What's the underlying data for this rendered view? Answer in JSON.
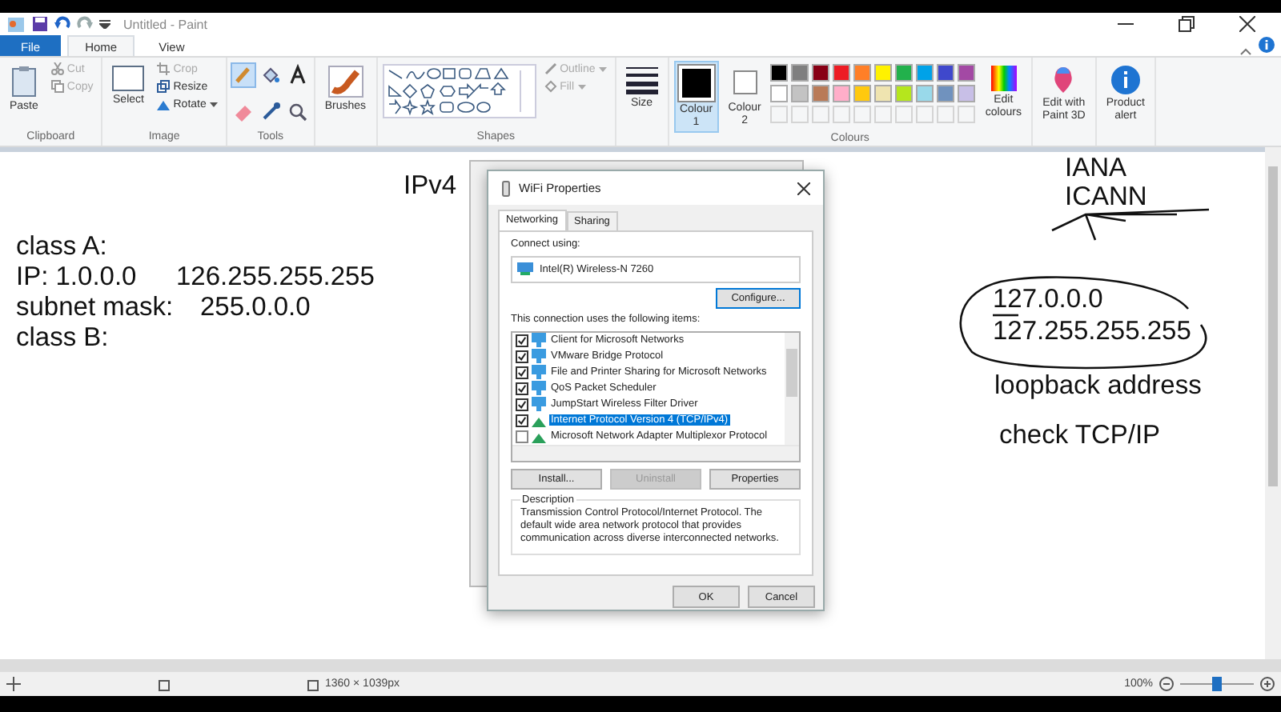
{
  "window": {
    "title": "Untitled - Paint"
  },
  "ribbon_tabs": [
    {
      "label": "File",
      "kind": "file",
      "selected": false
    },
    {
      "label": "Home",
      "kind": "tab",
      "selected": true
    },
    {
      "label": "View",
      "kind": "tab",
      "selected": false
    }
  ],
  "ribbon": {
    "clipboard": {
      "label": "Clipboard",
      "paste": "Paste",
      "cut": {
        "label": "Cut",
        "disabled": true
      },
      "copy": {
        "label": "Copy",
        "disabled": true
      }
    },
    "image": {
      "label": "Image",
      "select": "Select",
      "crop": {
        "label": "Crop",
        "disabled": true
      },
      "resize": {
        "label": "Resize",
        "disabled": false
      },
      "rotate": {
        "label": "Rotate",
        "disabled": false
      }
    },
    "tools": {
      "label": "Tools"
    },
    "brushes": "Brushes",
    "shapes": {
      "label": "Shapes",
      "outline": {
        "label": "Outline",
        "disabled": true
      },
      "fill": {
        "label": "Fill",
        "disabled": true
      }
    },
    "size": "Size",
    "colours": {
      "label": "Colours",
      "colour1": {
        "label": "Colour",
        "number": "1",
        "selected": true
      },
      "colour2": {
        "label": "Colour",
        "number": "2",
        "selected": false
      },
      "palette": [
        {
          "color": "#000000"
        },
        {
          "color": "#7f7f7f"
        },
        {
          "color": "#880015"
        },
        {
          "color": "#ed1c24"
        },
        {
          "color": "#ff7f27"
        },
        {
          "color": "#fff200"
        },
        {
          "color": "#22b14c"
        },
        {
          "color": "#00a2e8"
        },
        {
          "color": "#3f48cc"
        },
        {
          "color": "#a349a4"
        },
        {
          "color": "#ffffff"
        },
        {
          "color": "#c3c3c3"
        },
        {
          "color": "#b97a57"
        },
        {
          "color": "#ffaec9"
        },
        {
          "color": "#ffc90e"
        },
        {
          "color": "#efe4b0"
        },
        {
          "color": "#b5e61d"
        },
        {
          "color": "#99d9ea"
        },
        {
          "color": "#7092be"
        },
        {
          "color": "#c8bfe7"
        }
      ],
      "edit": [
        "Edit",
        "colours"
      ]
    },
    "paint3d": [
      "Edit with",
      "Paint 3D"
    ],
    "product_alert": [
      "Product",
      "alert"
    ]
  },
  "canvas": {
    "behind_dialog": "IPv4",
    "left_notes": [
      [
        "class A:"
      ],
      [
        "IP: 1.0.0.0",
        "126.255.255.255"
      ],
      [
        "subnet mask:",
        "255.0.0.0"
      ],
      [
        "class B:"
      ]
    ],
    "right_notes": {
      "org_lines": [
        "IANA",
        "ICANN"
      ],
      "range": [
        "127.0.0.0",
        "127.255.255.255"
      ],
      "caption": "loopback address",
      "note": "check TCP/IP"
    }
  },
  "dialog": {
    "title": "WiFi Properties",
    "tabs": [
      {
        "label": "Networking",
        "selected": true
      },
      {
        "label": "Sharing",
        "selected": false
      }
    ],
    "connect_label": "Connect using:",
    "adapter": "Intel(R) Wireless-N 7260",
    "configure": "Configure...",
    "items_label": "This connection uses the following items:",
    "items": [
      {
        "label": "Client for Microsoft Networks",
        "kind": "network",
        "checked": true,
        "selected": false
      },
      {
        "label": "VMware Bridge Protocol",
        "kind": "network",
        "checked": true,
        "selected": false
      },
      {
        "label": "File and Printer Sharing for Microsoft Networks",
        "kind": "network",
        "checked": true,
        "selected": false
      },
      {
        "label": "QoS Packet Scheduler",
        "kind": "network",
        "checked": true,
        "selected": false
      },
      {
        "label": "JumpStart Wireless Filter Driver",
        "kind": "network",
        "checked": true,
        "selected": false
      },
      {
        "label": "Internet Protocol Version 4 (TCP/IPv4)",
        "kind": "protocol",
        "checked": true,
        "selected": true
      },
      {
        "label": "Microsoft Network Adapter Multiplexor Protocol",
        "kind": "protocol",
        "checked": false,
        "selected": false
      }
    ],
    "buttons": [
      {
        "label": "Install...",
        "disabled": false
      },
      {
        "label": "Uninstall",
        "disabled": true
      },
      {
        "label": "Properties",
        "disabled": false
      }
    ],
    "description_label": "Description",
    "description": "Transmission Control Protocol/Internet Protocol. The default wide area network protocol that provides communication across diverse interconnected networks.",
    "ok": "OK",
    "cancel": "Cancel"
  },
  "status_bar": {
    "dimensions": "1360 × 1039px",
    "zoom": "100%",
    "level": 0.5
  }
}
